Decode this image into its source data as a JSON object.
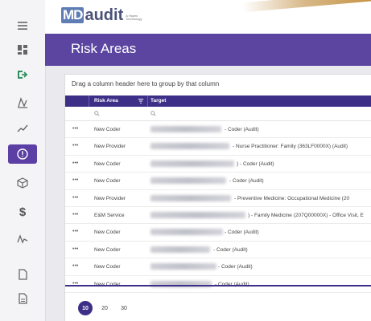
{
  "colors": {
    "accent": "#5b45a0",
    "grid_header": "#3d2f88",
    "active_nav": "#5b3fa5"
  },
  "logo": {
    "mark": "MD",
    "word": "audit",
    "tagline": "A Hayes Technology"
  },
  "page": {
    "title": "Risk Areas"
  },
  "grid": {
    "group_hint": "Drag a column header here to group by that column",
    "columns": [
      "Risk Area",
      "Target"
    ],
    "filter_icon": "filter-icon",
    "rows": [
      {
        "menu": "•••",
        "area": "New Coder",
        "target": "- Coder (Audit)"
      },
      {
        "menu": "•••",
        "area": "New Provider",
        "target": "- Nurse Practitioner: Family (363LF0000X) (Audit)"
      },
      {
        "menu": "•••",
        "area": "New Coder",
        "target": ") - Coder (Audit)"
      },
      {
        "menu": "•••",
        "area": "New Coder",
        "target": "- Coder (Audit)"
      },
      {
        "menu": "•••",
        "area": "New Provider",
        "target": "- Preventive Medicine: Occupational Medicine (20"
      },
      {
        "menu": "•••",
        "area": "E&M Service",
        "target": ") - Family Medicine (207Q00000X) - Office Visit, E"
      },
      {
        "menu": "•••",
        "area": "New Coder",
        "target": "- Coder (Audit)"
      },
      {
        "menu": "•••",
        "area": "New Coder",
        "target": "- Coder (Audit)"
      },
      {
        "menu": "•••",
        "area": "New Coder",
        "target": "- Coder (Audit)"
      },
      {
        "menu": "•••",
        "area": "New Coder",
        "target": "- Coder (Audit)"
      }
    ]
  },
  "pager": {
    "sizes": [
      "10",
      "20",
      "30"
    ],
    "selected": "10"
  },
  "nav": {
    "items": [
      "menu-icon",
      "dashboard-icon",
      "logout-icon",
      "chart-icon",
      "trend-icon",
      "risk-area-icon",
      "box-icon",
      "dollar-icon",
      "pulse-icon",
      "document-icon",
      "file-icon"
    ],
    "active": "risk-area-icon",
    "dollar_glyph": "$"
  }
}
